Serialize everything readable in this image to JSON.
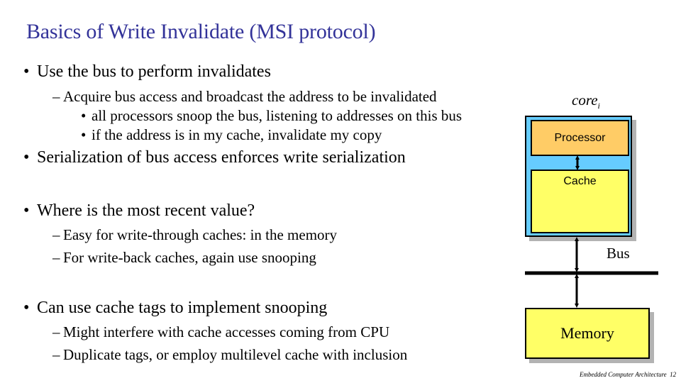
{
  "slide": {
    "title": "Basics of Write Invalidate (MSI protocol)",
    "bullet_glyph": "•",
    "dash_glyph": "–",
    "items": [
      {
        "level": 1,
        "text": "Use the bus to perform invalidates"
      },
      {
        "level": 2,
        "text": "Acquire bus access and broadcast the address to be invalidated"
      },
      {
        "level": 3,
        "text": "all processors snoop the bus, listening to addresses on this bus"
      },
      {
        "level": 3,
        "text": "if the address is in my cache, invalidate my copy"
      },
      {
        "level": 1,
        "text": "Serialization of bus access enforces write serialization"
      },
      {
        "level": 1,
        "text": "Where is the most recent value?"
      },
      {
        "level": 2,
        "text": "Easy for write-through caches: in the memory"
      },
      {
        "level": 2,
        "text": "For write-back caches, again use snooping"
      },
      {
        "level": 1,
        "text": "Can use cache tags to implement snooping"
      },
      {
        "level": 2,
        "text": "Might interfere with cache accesses coming from CPU"
      },
      {
        "level": 2,
        "text": "Duplicate tags, or employ multilevel cache with inclusion"
      }
    ]
  },
  "diagram": {
    "core_label": "core",
    "core_subscript": "i",
    "processor_label": "Processor",
    "cache_label": "Cache",
    "bus_label": "Bus",
    "memory_label": "Memory",
    "colors": {
      "core": "#66ccff",
      "processor": "#ffcc66",
      "cache": "#ffff66",
      "memory": "#ffff66",
      "title": "#333399"
    }
  },
  "footer": {
    "course": "Embedded Computer Architecture",
    "page": "12"
  }
}
